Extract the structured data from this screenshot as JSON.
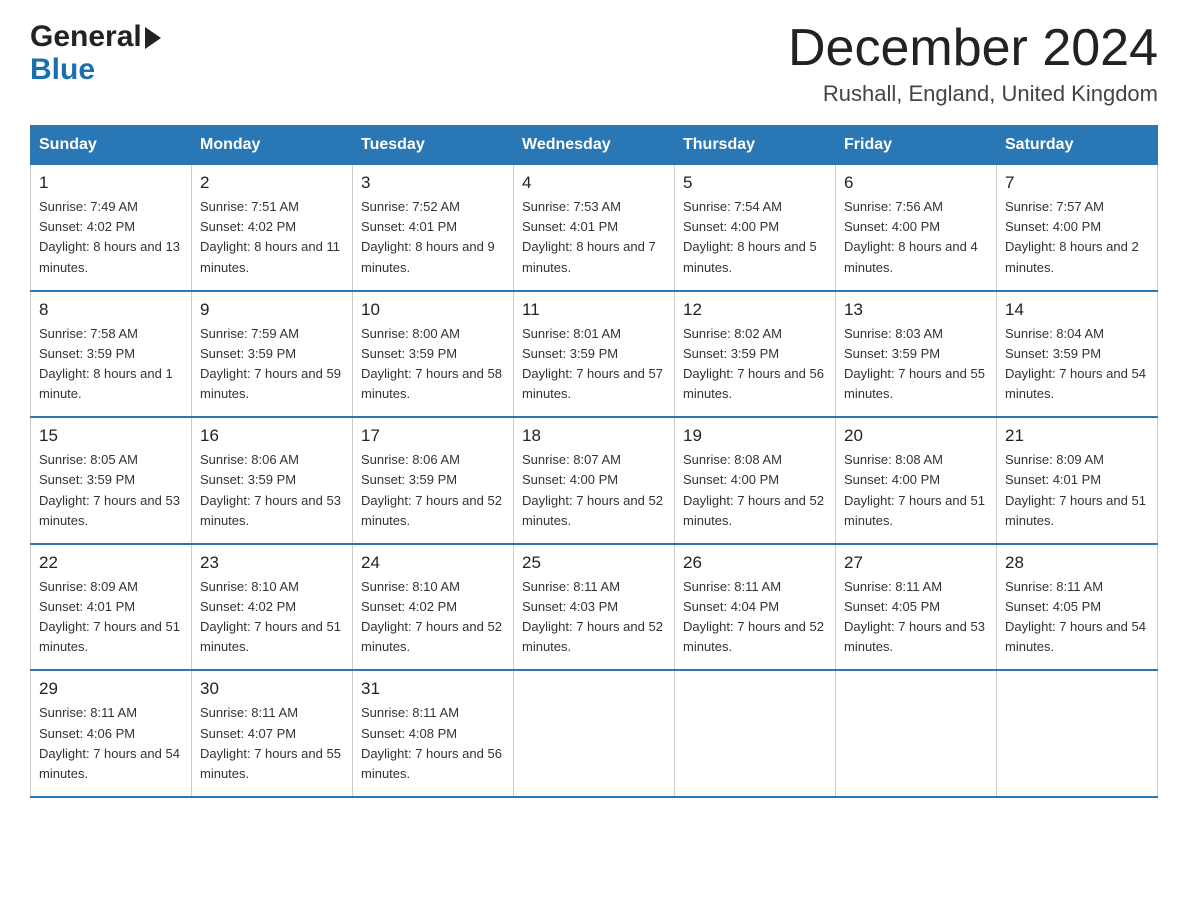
{
  "header": {
    "logo_general": "General",
    "logo_blue": "Blue",
    "month_title": "December 2024",
    "location": "Rushall, England, United Kingdom"
  },
  "weekdays": [
    "Sunday",
    "Monday",
    "Tuesday",
    "Wednesday",
    "Thursday",
    "Friday",
    "Saturday"
  ],
  "weeks": [
    [
      {
        "day": "1",
        "sunrise": "7:49 AM",
        "sunset": "4:02 PM",
        "daylight": "8 hours and 13 minutes."
      },
      {
        "day": "2",
        "sunrise": "7:51 AM",
        "sunset": "4:02 PM",
        "daylight": "8 hours and 11 minutes."
      },
      {
        "day": "3",
        "sunrise": "7:52 AM",
        "sunset": "4:01 PM",
        "daylight": "8 hours and 9 minutes."
      },
      {
        "day": "4",
        "sunrise": "7:53 AM",
        "sunset": "4:01 PM",
        "daylight": "8 hours and 7 minutes."
      },
      {
        "day": "5",
        "sunrise": "7:54 AM",
        "sunset": "4:00 PM",
        "daylight": "8 hours and 5 minutes."
      },
      {
        "day": "6",
        "sunrise": "7:56 AM",
        "sunset": "4:00 PM",
        "daylight": "8 hours and 4 minutes."
      },
      {
        "day": "7",
        "sunrise": "7:57 AM",
        "sunset": "4:00 PM",
        "daylight": "8 hours and 2 minutes."
      }
    ],
    [
      {
        "day": "8",
        "sunrise": "7:58 AM",
        "sunset": "3:59 PM",
        "daylight": "8 hours and 1 minute."
      },
      {
        "day": "9",
        "sunrise": "7:59 AM",
        "sunset": "3:59 PM",
        "daylight": "7 hours and 59 minutes."
      },
      {
        "day": "10",
        "sunrise": "8:00 AM",
        "sunset": "3:59 PM",
        "daylight": "7 hours and 58 minutes."
      },
      {
        "day": "11",
        "sunrise": "8:01 AM",
        "sunset": "3:59 PM",
        "daylight": "7 hours and 57 minutes."
      },
      {
        "day": "12",
        "sunrise": "8:02 AM",
        "sunset": "3:59 PM",
        "daylight": "7 hours and 56 minutes."
      },
      {
        "day": "13",
        "sunrise": "8:03 AM",
        "sunset": "3:59 PM",
        "daylight": "7 hours and 55 minutes."
      },
      {
        "day": "14",
        "sunrise": "8:04 AM",
        "sunset": "3:59 PM",
        "daylight": "7 hours and 54 minutes."
      }
    ],
    [
      {
        "day": "15",
        "sunrise": "8:05 AM",
        "sunset": "3:59 PM",
        "daylight": "7 hours and 53 minutes."
      },
      {
        "day": "16",
        "sunrise": "8:06 AM",
        "sunset": "3:59 PM",
        "daylight": "7 hours and 53 minutes."
      },
      {
        "day": "17",
        "sunrise": "8:06 AM",
        "sunset": "3:59 PM",
        "daylight": "7 hours and 52 minutes."
      },
      {
        "day": "18",
        "sunrise": "8:07 AM",
        "sunset": "4:00 PM",
        "daylight": "7 hours and 52 minutes."
      },
      {
        "day": "19",
        "sunrise": "8:08 AM",
        "sunset": "4:00 PM",
        "daylight": "7 hours and 52 minutes."
      },
      {
        "day": "20",
        "sunrise": "8:08 AM",
        "sunset": "4:00 PM",
        "daylight": "7 hours and 51 minutes."
      },
      {
        "day": "21",
        "sunrise": "8:09 AM",
        "sunset": "4:01 PM",
        "daylight": "7 hours and 51 minutes."
      }
    ],
    [
      {
        "day": "22",
        "sunrise": "8:09 AM",
        "sunset": "4:01 PM",
        "daylight": "7 hours and 51 minutes."
      },
      {
        "day": "23",
        "sunrise": "8:10 AM",
        "sunset": "4:02 PM",
        "daylight": "7 hours and 51 minutes."
      },
      {
        "day": "24",
        "sunrise": "8:10 AM",
        "sunset": "4:02 PM",
        "daylight": "7 hours and 52 minutes."
      },
      {
        "day": "25",
        "sunrise": "8:11 AM",
        "sunset": "4:03 PM",
        "daylight": "7 hours and 52 minutes."
      },
      {
        "day": "26",
        "sunrise": "8:11 AM",
        "sunset": "4:04 PM",
        "daylight": "7 hours and 52 minutes."
      },
      {
        "day": "27",
        "sunrise": "8:11 AM",
        "sunset": "4:05 PM",
        "daylight": "7 hours and 53 minutes."
      },
      {
        "day": "28",
        "sunrise": "8:11 AM",
        "sunset": "4:05 PM",
        "daylight": "7 hours and 54 minutes."
      }
    ],
    [
      {
        "day": "29",
        "sunrise": "8:11 AM",
        "sunset": "4:06 PM",
        "daylight": "7 hours and 54 minutes."
      },
      {
        "day": "30",
        "sunrise": "8:11 AM",
        "sunset": "4:07 PM",
        "daylight": "7 hours and 55 minutes."
      },
      {
        "day": "31",
        "sunrise": "8:11 AM",
        "sunset": "4:08 PM",
        "daylight": "7 hours and 56 minutes."
      },
      null,
      null,
      null,
      null
    ]
  ]
}
